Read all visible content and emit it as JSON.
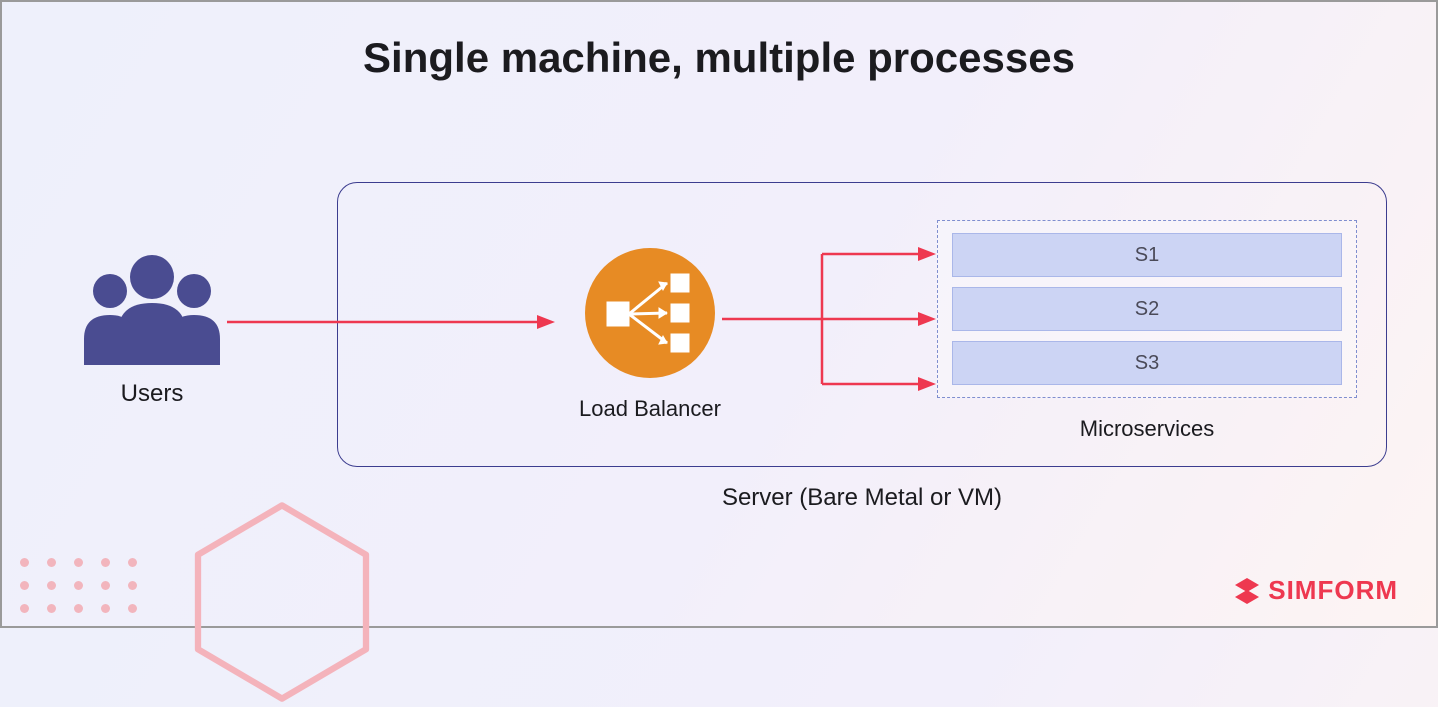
{
  "title": "Single machine, multiple processes",
  "users": {
    "label": "Users"
  },
  "server": {
    "label": "Server (Bare Metal or VM)"
  },
  "load_balancer": {
    "label": "Load Balancer"
  },
  "microservices": {
    "label": "Microservices",
    "items": [
      "S1",
      "S2",
      "S3"
    ]
  },
  "brand": {
    "name": "SIMFORM"
  },
  "colors": {
    "accent_purple": "#4a4c91",
    "accent_orange": "#e78b24",
    "arrow_red": "#ee3850",
    "service_bg": "#ccd4f4"
  }
}
